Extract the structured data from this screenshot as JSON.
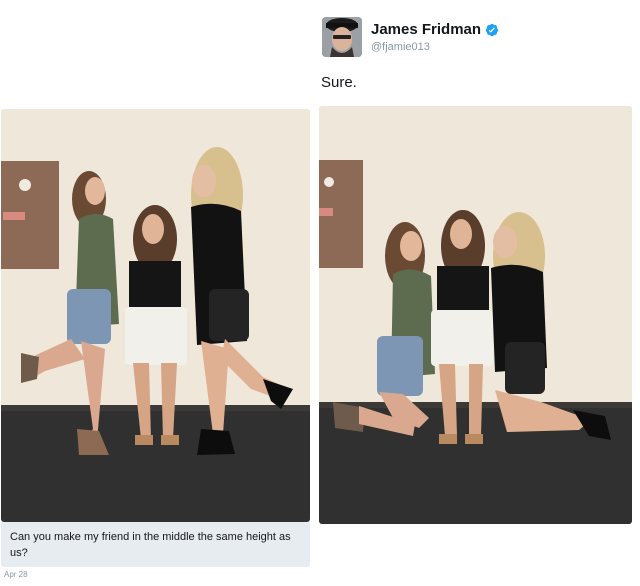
{
  "reply": {
    "author_name": "James Fridman",
    "author_handle": "@fjamie013",
    "text": "Sure.",
    "verified_icon": "verified-badge-icon",
    "verified_color": "#1da1f2"
  },
  "request": {
    "text": "Can you make my friend in the middle the same height as us?",
    "date": "Apr 28"
  },
  "colors": {
    "wall": "#efe7da",
    "floor": "#2f302f",
    "caption_bg": "#e6ecf0",
    "muted_text": "#8899a6"
  }
}
